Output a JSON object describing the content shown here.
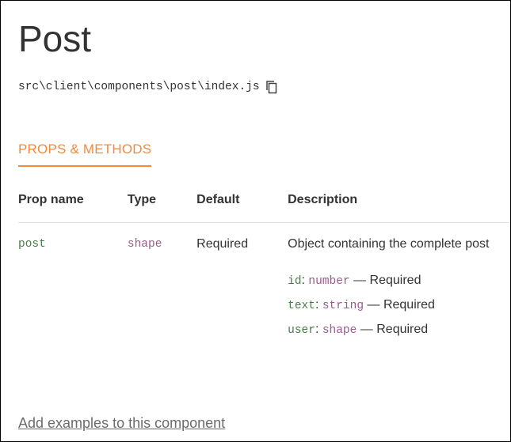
{
  "component": {
    "title": "Post",
    "path": "src\\client\\components\\post\\index.js"
  },
  "icons": {
    "copy": "copy-icon"
  },
  "section": {
    "tab_label": "PROPS & METHODS"
  },
  "props_table": {
    "headers": [
      "Prop name",
      "Type",
      "Default",
      "Description"
    ],
    "rows": [
      {
        "name": "post",
        "type": "shape",
        "default": "Required",
        "description": "Object containing the complete post",
        "fields": [
          {
            "name": "id",
            "sep": ": ",
            "type": "number",
            "note": " — Required"
          },
          {
            "name": "text",
            "sep": ": ",
            "type": "string",
            "note": " — Required"
          },
          {
            "name": "user",
            "sep": ": ",
            "type": "shape",
            "note": " — Required"
          }
        ]
      }
    ]
  },
  "footer": {
    "examples_link": "Add examples to this component"
  },
  "colors": {
    "accent": "#f28a3c",
    "prop_name": "#4a7a4a",
    "prop_type": "#9a5b8c",
    "link": "#6b6b6b"
  }
}
